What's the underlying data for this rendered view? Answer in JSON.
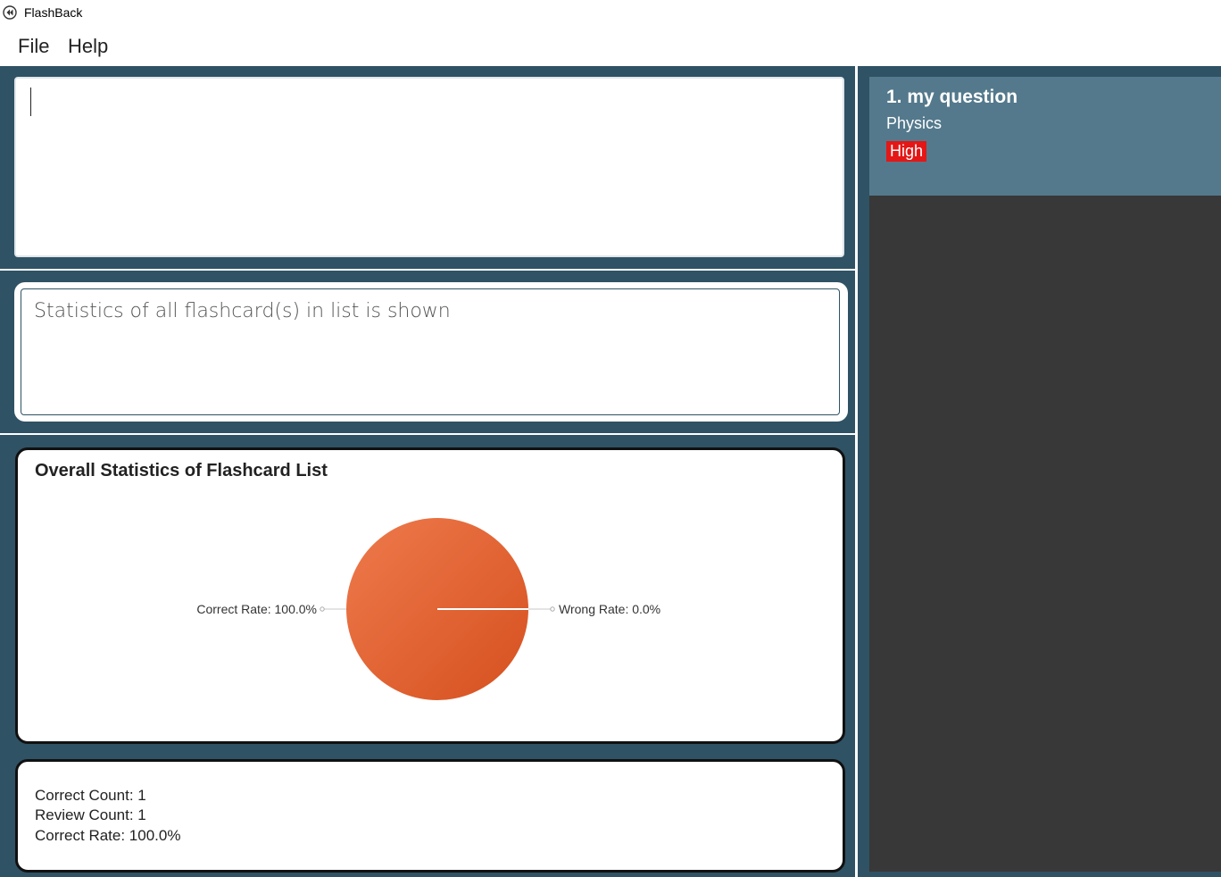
{
  "window": {
    "title": "FlashBack"
  },
  "menu": {
    "file": "File",
    "help": "Help"
  },
  "command_box": {
    "value": ""
  },
  "result_display": {
    "text": "Statistics of all flashcard(s) in list is shown"
  },
  "stats_panel": {
    "title": "Overall Statistics of Flashcard List"
  },
  "chart_data": {
    "type": "pie",
    "title": "Overall Statistics of Flashcard List",
    "slices": [
      {
        "label": "Correct Rate: 100.0%",
        "value": 100.0
      },
      {
        "label": "Wrong Rate: 0.0%",
        "value": 0.0
      }
    ],
    "colors": {
      "correct": "#e2562a",
      "correct_light": "#ed7a4e"
    }
  },
  "counts": {
    "correct_count": "Correct Count: 1",
    "review_count": "Review Count: 1",
    "correct_rate": "Correct Rate: 100.0%"
  },
  "flashcard_list": {
    "items": [
      {
        "index_question": "1.  my question",
        "category": "Physics",
        "tag": "High"
      }
    ]
  },
  "colors": {
    "background": "#2f5265",
    "card_selected": "#54798c",
    "list_bg": "#383838",
    "tag_high": "#e51616"
  }
}
